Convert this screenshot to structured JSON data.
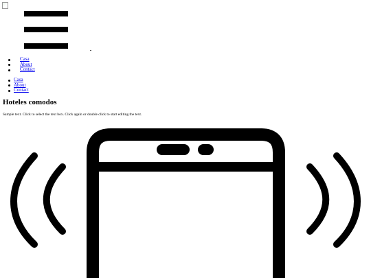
{
  "header": {
    "logo_icon": "broken-image-icon",
    "menu_icon": "hamburger-menu-icon"
  },
  "nav_primary": {
    "items": [
      {
        "label": "Casa"
      },
      {
        "label": "About"
      },
      {
        "label": "Contact"
      }
    ]
  },
  "nav_secondary": {
    "items": [
      {
        "label": "Casa"
      },
      {
        "label": "About"
      },
      {
        "label": "Contact"
      }
    ]
  },
  "content": {
    "heading": "Hoteles comodos",
    "sample_text": "Sample text. Click to select the text box. Click again or double click to start editing the text.",
    "illustration_icon": "phone-vibrating-icon"
  },
  "colors": {
    "link": "#0000ee",
    "text": "#000000",
    "background": "#ffffff"
  }
}
